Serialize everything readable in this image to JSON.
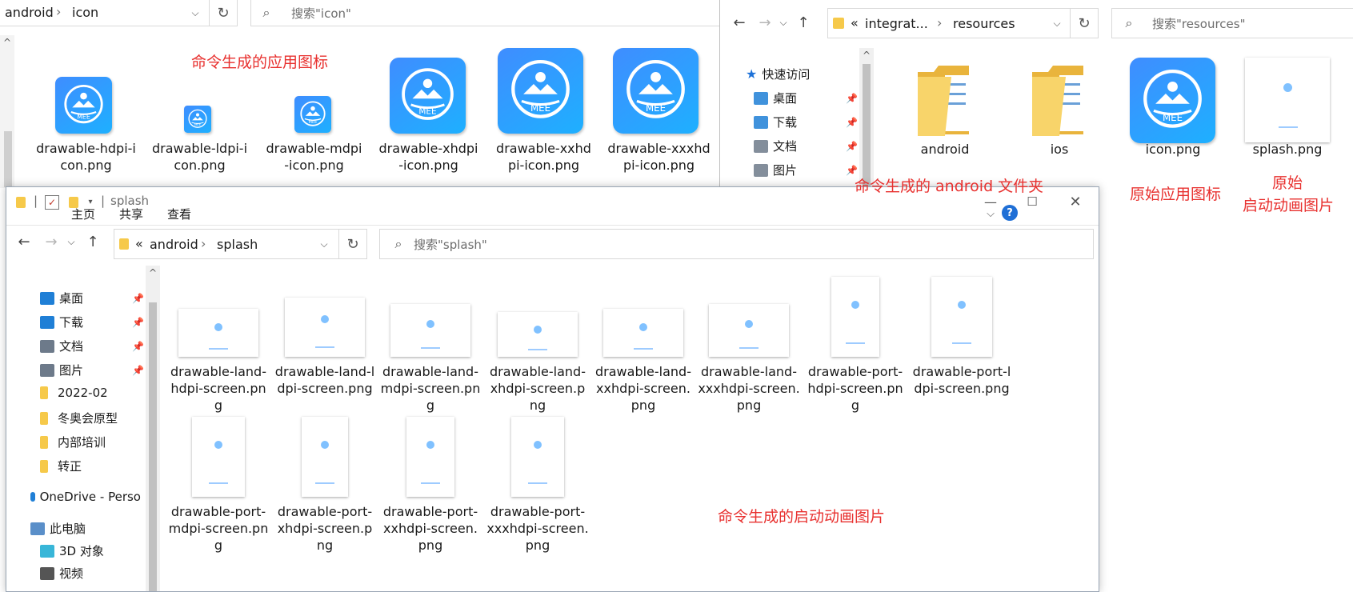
{
  "icon_window": {
    "breadcrumb": [
      "android",
      "icon"
    ],
    "search_placeholder": "搜索\"icon\"",
    "files": [
      {
        "name": "drawable-hdpi-icon.png",
        "line1": "drawable-hdpi-i",
        "line2": "con.png"
      },
      {
        "name": "drawable-ldpi-icon.png",
        "line1": "drawable-ldpi-i",
        "line2": "con.png"
      },
      {
        "name": "drawable-mdpi-icon.png",
        "line1": "drawable-mdpi",
        "line2": "-icon.png"
      },
      {
        "name": "drawable-xhdpi-icon.png",
        "line1": "drawable-xhdpi",
        "line2": "-icon.png"
      },
      {
        "name": "drawable-xxhdpi-icon.png",
        "line1": "drawable-xxhd",
        "line2": "pi-icon.png"
      },
      {
        "name": "drawable-xxxhdpi-icon.png",
        "line1": "drawable-xxxhd",
        "line2": "pi-icon.png"
      }
    ],
    "icon_text": "MEE"
  },
  "resources_window": {
    "breadcrumb_prefix": "«",
    "breadcrumb": [
      "integrat...",
      "resources"
    ],
    "search_placeholder": "搜索\"resources\"",
    "nav": {
      "quick_access": "快速访问",
      "items": [
        "桌面",
        "下载",
        "文档",
        "图片"
      ]
    },
    "files": [
      {
        "name": "android"
      },
      {
        "name": "ios"
      },
      {
        "name": "icon.png"
      },
      {
        "name": "splash.png"
      }
    ]
  },
  "splash_window": {
    "title": "splash",
    "ribbon_tabs": [
      "主页",
      "共享",
      "查看"
    ],
    "breadcrumb_prefix": "«",
    "breadcrumb": [
      "android",
      "splash"
    ],
    "search_placeholder": "搜索\"splash\"",
    "nav": {
      "items": [
        "桌面",
        "下载",
        "文档",
        "图片",
        "2022-02",
        "冬奥会原型",
        "内部培训",
        "转正"
      ],
      "onedrive": "OneDrive - Perso",
      "this_pc": "此电脑",
      "pc_items": [
        "3D 对象",
        "视频"
      ]
    },
    "files": [
      {
        "name": "drawable-land-hdpi-screen.png",
        "lines": [
          "drawable-land-",
          "hdpi-screen.pn",
          "g"
        ]
      },
      {
        "name": "drawable-land-ldpi-screen.png",
        "lines": [
          "drawable-land-l",
          "dpi-screen.png"
        ]
      },
      {
        "name": "drawable-land-mdpi-screen.png",
        "lines": [
          "drawable-land-",
          "mdpi-screen.pn",
          "g"
        ]
      },
      {
        "name": "drawable-land-xhdpi-screen.png",
        "lines": [
          "drawable-land-",
          "xhdpi-screen.p",
          "ng"
        ]
      },
      {
        "name": "drawable-land-xxhdpi-screen.png",
        "lines": [
          "drawable-land-",
          "xxhdpi-screen.",
          "png"
        ]
      },
      {
        "name": "drawable-land-xxxhdpi-screen.png",
        "lines": [
          "drawable-land-",
          "xxxhdpi-screen.",
          "png"
        ]
      },
      {
        "name": "drawable-port-hdpi-screen.png",
        "lines": [
          "drawable-port-",
          "hdpi-screen.pn",
          "g"
        ]
      },
      {
        "name": "drawable-port-ldpi-screen.png",
        "lines": [
          "drawable-port-l",
          "dpi-screen.png"
        ]
      },
      {
        "name": "drawable-port-mdpi-screen.png",
        "lines": [
          "drawable-port-",
          "mdpi-screen.pn",
          "g"
        ]
      },
      {
        "name": "drawable-port-xhdpi-screen.png",
        "lines": [
          "drawable-port-",
          "xhdpi-screen.p",
          "ng"
        ]
      },
      {
        "name": "drawable-port-xxhdpi-screen.png",
        "lines": [
          "drawable-port-",
          "xxhdpi-screen.",
          "png"
        ]
      },
      {
        "name": "drawable-port-xxxhdpi-screen.png",
        "lines": [
          "drawable-port-",
          "xxxhdpi-screen.",
          "png"
        ]
      }
    ]
  },
  "annotations": {
    "app_icons": "命令生成的应用图标",
    "android_folder": "命令生成的 android 文件夹",
    "original_icon": "原始应用图标",
    "original_splash_1": "原始",
    "original_splash_2": "启动动画图片",
    "splash_images": "命令生成的启动动画图片"
  },
  "colors": {
    "annotation_red": "#e8312f",
    "icon_blue_start": "#3f8dff",
    "icon_blue_end": "#1eb0ff",
    "folder_yellow": "#f6c94a",
    "help_blue": "#1f6fd6"
  }
}
